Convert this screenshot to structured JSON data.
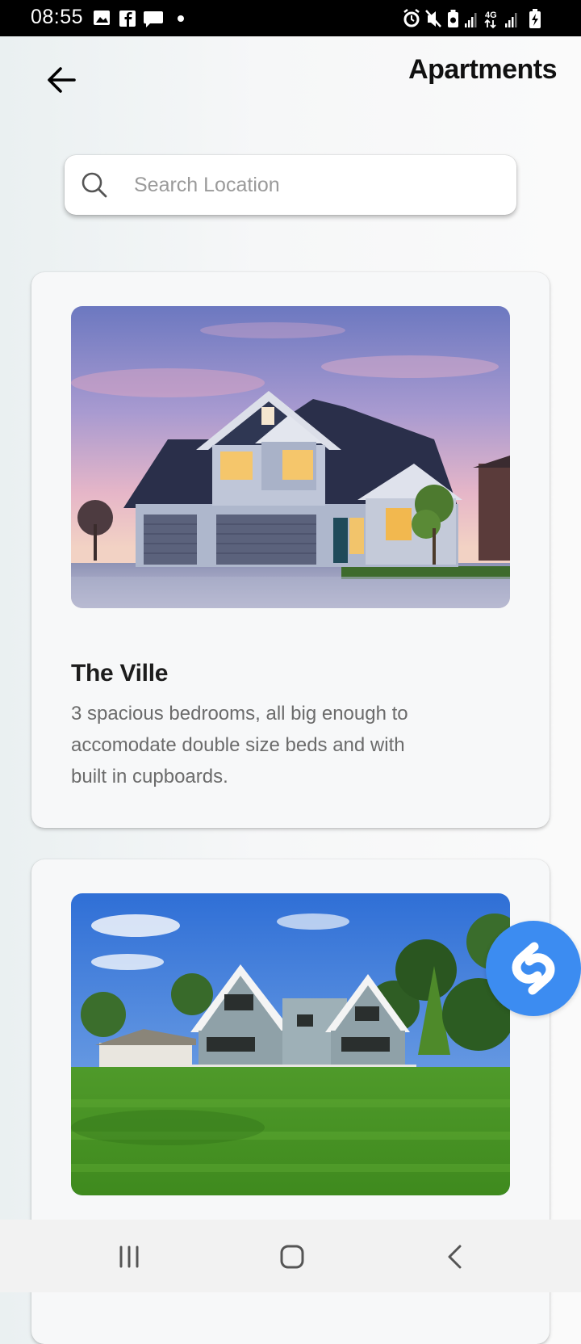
{
  "status_bar": {
    "time": "08:55",
    "left_icons": [
      "gallery-icon",
      "facebook-icon",
      "chat-icon",
      "dot-icon"
    ],
    "right_icons": [
      "alarm-icon",
      "mute-icon",
      "battery-saver-icon",
      "signal-icon",
      "4g-icon",
      "signal-icon",
      "battery-icon"
    ]
  },
  "header": {
    "title": "Apartments",
    "back_icon": "arrow-left-icon"
  },
  "search": {
    "placeholder": "Search Location",
    "value": "",
    "icon": "search-icon"
  },
  "listings": [
    {
      "title": "The Ville",
      "description": "3 spacious bedrooms, all big enough to accomodate double size beds and with built in cupboards.",
      "image": "house-dusk-photo"
    },
    {
      "title": "",
      "description": "",
      "image": "house-lawn-photo"
    }
  ],
  "floating_button": {
    "icon": "shazam-icon",
    "color": "#3c8cf1"
  },
  "nav_bar": {
    "buttons": [
      "recents-icon",
      "home-icon",
      "back-icon"
    ]
  }
}
